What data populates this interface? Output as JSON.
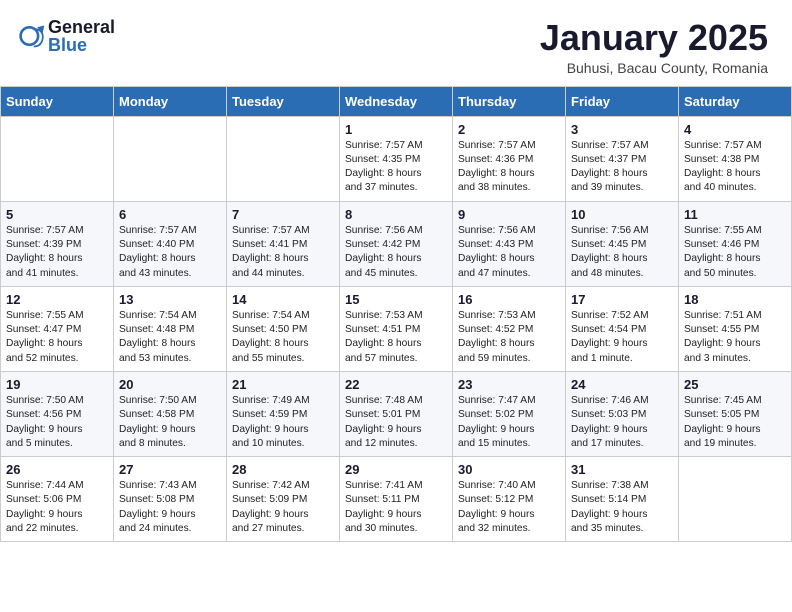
{
  "header": {
    "logo_general": "General",
    "logo_blue": "Blue",
    "month_title": "January 2025",
    "location": "Buhusi, Bacau County, Romania"
  },
  "weekdays": [
    "Sunday",
    "Monday",
    "Tuesday",
    "Wednesday",
    "Thursday",
    "Friday",
    "Saturday"
  ],
  "weeks": [
    [
      {
        "day": "",
        "info": ""
      },
      {
        "day": "",
        "info": ""
      },
      {
        "day": "",
        "info": ""
      },
      {
        "day": "1",
        "info": "Sunrise: 7:57 AM\nSunset: 4:35 PM\nDaylight: 8 hours\nand 37 minutes."
      },
      {
        "day": "2",
        "info": "Sunrise: 7:57 AM\nSunset: 4:36 PM\nDaylight: 8 hours\nand 38 minutes."
      },
      {
        "day": "3",
        "info": "Sunrise: 7:57 AM\nSunset: 4:37 PM\nDaylight: 8 hours\nand 39 minutes."
      },
      {
        "day": "4",
        "info": "Sunrise: 7:57 AM\nSunset: 4:38 PM\nDaylight: 8 hours\nand 40 minutes."
      }
    ],
    [
      {
        "day": "5",
        "info": "Sunrise: 7:57 AM\nSunset: 4:39 PM\nDaylight: 8 hours\nand 41 minutes."
      },
      {
        "day": "6",
        "info": "Sunrise: 7:57 AM\nSunset: 4:40 PM\nDaylight: 8 hours\nand 43 minutes."
      },
      {
        "day": "7",
        "info": "Sunrise: 7:57 AM\nSunset: 4:41 PM\nDaylight: 8 hours\nand 44 minutes."
      },
      {
        "day": "8",
        "info": "Sunrise: 7:56 AM\nSunset: 4:42 PM\nDaylight: 8 hours\nand 45 minutes."
      },
      {
        "day": "9",
        "info": "Sunrise: 7:56 AM\nSunset: 4:43 PM\nDaylight: 8 hours\nand 47 minutes."
      },
      {
        "day": "10",
        "info": "Sunrise: 7:56 AM\nSunset: 4:45 PM\nDaylight: 8 hours\nand 48 minutes."
      },
      {
        "day": "11",
        "info": "Sunrise: 7:55 AM\nSunset: 4:46 PM\nDaylight: 8 hours\nand 50 minutes."
      }
    ],
    [
      {
        "day": "12",
        "info": "Sunrise: 7:55 AM\nSunset: 4:47 PM\nDaylight: 8 hours\nand 52 minutes."
      },
      {
        "day": "13",
        "info": "Sunrise: 7:54 AM\nSunset: 4:48 PM\nDaylight: 8 hours\nand 53 minutes."
      },
      {
        "day": "14",
        "info": "Sunrise: 7:54 AM\nSunset: 4:50 PM\nDaylight: 8 hours\nand 55 minutes."
      },
      {
        "day": "15",
        "info": "Sunrise: 7:53 AM\nSunset: 4:51 PM\nDaylight: 8 hours\nand 57 minutes."
      },
      {
        "day": "16",
        "info": "Sunrise: 7:53 AM\nSunset: 4:52 PM\nDaylight: 8 hours\nand 59 minutes."
      },
      {
        "day": "17",
        "info": "Sunrise: 7:52 AM\nSunset: 4:54 PM\nDaylight: 9 hours\nand 1 minute."
      },
      {
        "day": "18",
        "info": "Sunrise: 7:51 AM\nSunset: 4:55 PM\nDaylight: 9 hours\nand 3 minutes."
      }
    ],
    [
      {
        "day": "19",
        "info": "Sunrise: 7:50 AM\nSunset: 4:56 PM\nDaylight: 9 hours\nand 5 minutes."
      },
      {
        "day": "20",
        "info": "Sunrise: 7:50 AM\nSunset: 4:58 PM\nDaylight: 9 hours\nand 8 minutes."
      },
      {
        "day": "21",
        "info": "Sunrise: 7:49 AM\nSunset: 4:59 PM\nDaylight: 9 hours\nand 10 minutes."
      },
      {
        "day": "22",
        "info": "Sunrise: 7:48 AM\nSunset: 5:01 PM\nDaylight: 9 hours\nand 12 minutes."
      },
      {
        "day": "23",
        "info": "Sunrise: 7:47 AM\nSunset: 5:02 PM\nDaylight: 9 hours\nand 15 minutes."
      },
      {
        "day": "24",
        "info": "Sunrise: 7:46 AM\nSunset: 5:03 PM\nDaylight: 9 hours\nand 17 minutes."
      },
      {
        "day": "25",
        "info": "Sunrise: 7:45 AM\nSunset: 5:05 PM\nDaylight: 9 hours\nand 19 minutes."
      }
    ],
    [
      {
        "day": "26",
        "info": "Sunrise: 7:44 AM\nSunset: 5:06 PM\nDaylight: 9 hours\nand 22 minutes."
      },
      {
        "day": "27",
        "info": "Sunrise: 7:43 AM\nSunset: 5:08 PM\nDaylight: 9 hours\nand 24 minutes."
      },
      {
        "day": "28",
        "info": "Sunrise: 7:42 AM\nSunset: 5:09 PM\nDaylight: 9 hours\nand 27 minutes."
      },
      {
        "day": "29",
        "info": "Sunrise: 7:41 AM\nSunset: 5:11 PM\nDaylight: 9 hours\nand 30 minutes."
      },
      {
        "day": "30",
        "info": "Sunrise: 7:40 AM\nSunset: 5:12 PM\nDaylight: 9 hours\nand 32 minutes."
      },
      {
        "day": "31",
        "info": "Sunrise: 7:38 AM\nSunset: 5:14 PM\nDaylight: 9 hours\nand 35 minutes."
      },
      {
        "day": "",
        "info": ""
      }
    ]
  ]
}
